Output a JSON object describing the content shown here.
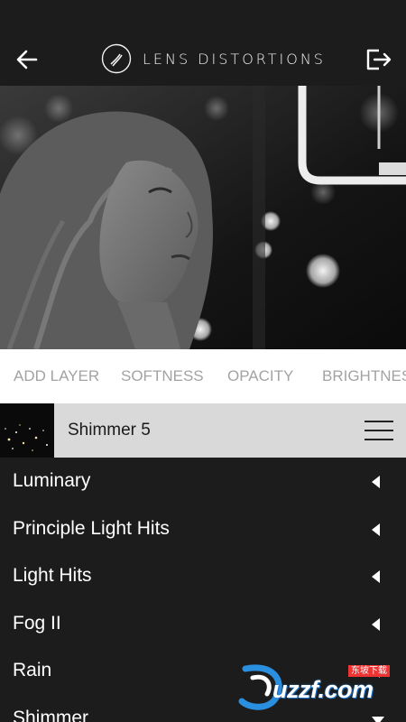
{
  "header": {
    "title": "LENS DISTORTIONS",
    "back_icon": "arrow-left-icon",
    "export_icon": "export-icon",
    "logo_icon": "lens-distortions-logo-icon"
  },
  "tabs": [
    {
      "label": "ADD LAYER"
    },
    {
      "label": "SOFTNESS"
    },
    {
      "label": "OPACITY"
    },
    {
      "label": "BRIGHTNESS"
    }
  ],
  "layer": {
    "name": "Shimmer 5",
    "menu_icon": "hamburger-menu-icon"
  },
  "list": {
    "items": [
      {
        "label": "Luminary",
        "state": "collapsed"
      },
      {
        "label": "Principle Light Hits",
        "state": "collapsed"
      },
      {
        "label": "Light Hits",
        "state": "collapsed"
      },
      {
        "label": "Fog II",
        "state": "collapsed"
      },
      {
        "label": "Rain",
        "state": "collapsed"
      },
      {
        "label": "Shimmer",
        "state": "expanded"
      }
    ]
  },
  "watermark": {
    "text": "uzzf.com",
    "small_text": "东坡下载"
  },
  "colors": {
    "background": "#1c1c1c",
    "tab_bar": "#ffffff",
    "tab_text": "#a3a3a3",
    "layer_bar": "#d9d9d9"
  }
}
